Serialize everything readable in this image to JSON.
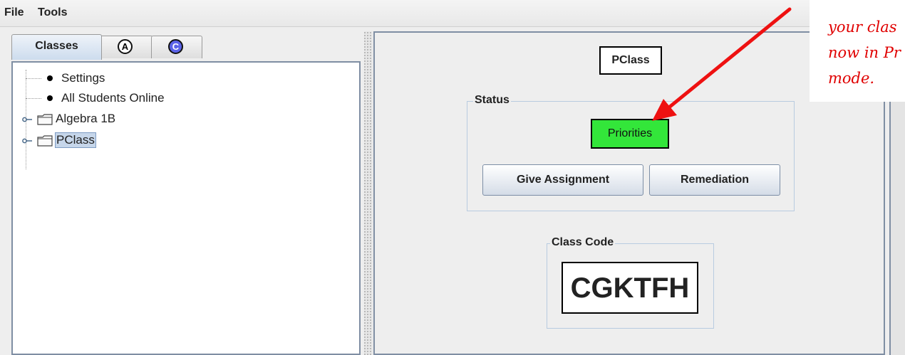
{
  "menubar": {
    "file": "File",
    "tools": "Tools"
  },
  "tabs": [
    {
      "label": "Classes",
      "active": true
    },
    {
      "icon_text": "A",
      "icon": "circle-a-icon"
    },
    {
      "icon_text": "C",
      "icon": "circle-c-icon",
      "icon_color": "#5b63e8"
    }
  ],
  "tree": {
    "items": [
      {
        "label": "Settings",
        "type": "leaf"
      },
      {
        "label": "All Students Online",
        "type": "leaf"
      },
      {
        "label": "Algebra 1B",
        "type": "folder"
      },
      {
        "label": "PClass",
        "type": "folder",
        "selected": true
      }
    ]
  },
  "detail": {
    "class_name": "PClass",
    "status_group_title": "Status",
    "status_value": "Priorities",
    "status_color": "#33e63a",
    "give_assignment_label": "Give Assignment",
    "remediation_label": "Remediation",
    "class_code_group_title": "Class Code",
    "class_code": "CGKTFH"
  },
  "annotation": {
    "lines": [
      "your clas",
      "now in Pr",
      "mode."
    ],
    "color": "#e00000"
  }
}
